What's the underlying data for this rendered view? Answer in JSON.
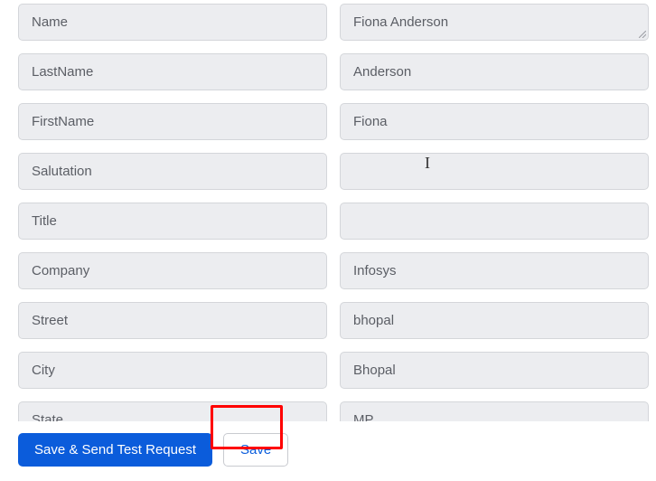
{
  "fields": [
    {
      "label": "Name",
      "value": "Fiona Anderson",
      "has_resize": true
    },
    {
      "label": "LastName",
      "value": "Anderson",
      "has_resize": false
    },
    {
      "label": "FirstName",
      "value": "Fiona",
      "has_resize": false
    },
    {
      "label": "Salutation",
      "value": "",
      "has_resize": false
    },
    {
      "label": "Title",
      "value": "",
      "has_resize": false
    },
    {
      "label": "Company",
      "value": "Infosys",
      "has_resize": false
    },
    {
      "label": "Street",
      "value": "bhopal",
      "has_resize": false
    },
    {
      "label": "City",
      "value": "Bhopal",
      "has_resize": false
    },
    {
      "label": "State",
      "value": "MP",
      "has_resize": false
    }
  ],
  "buttons": {
    "save_send_test": "Save & Send Test Request",
    "save": "Save"
  }
}
